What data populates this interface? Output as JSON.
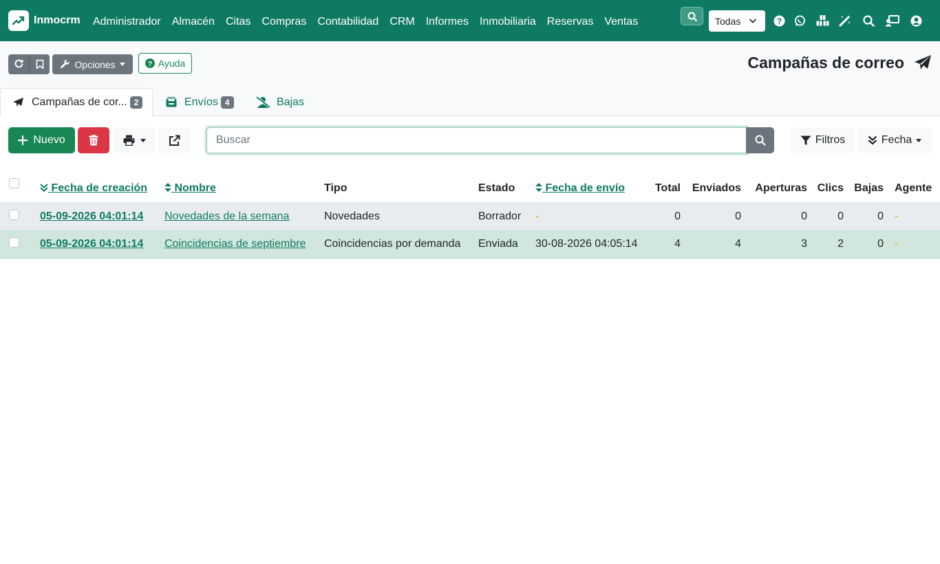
{
  "navbar": {
    "brand": "Inmocrm",
    "menu": [
      "Administrador",
      "Almacén",
      "Citas",
      "Compras",
      "Contabilidad",
      "CRM",
      "Informes",
      "Inmobiliaria",
      "Reservas",
      "Ventas"
    ],
    "company_select": "Todas",
    "icons": [
      "question-circle-icon",
      "whatsapp-icon",
      "cubes-icon",
      "magic-wand-icon",
      "search-icon",
      "screen-user-icon",
      "user-circle-icon"
    ],
    "accent": "#0f7a63"
  },
  "toolbar_top": {
    "options_label": "Opciones",
    "help_label": "Ayuda",
    "page_title": "Campañas de correo"
  },
  "tabs": [
    {
      "label": "Campañas de cor...",
      "badge": "2",
      "icon": "paper-plane-icon",
      "active": true
    },
    {
      "label": "Envíos",
      "badge": "4",
      "icon": "inbox-icon",
      "active": false
    },
    {
      "label": "Bajas",
      "badge": "",
      "icon": "user-slash-icon",
      "active": false
    }
  ],
  "actions": {
    "new_label": "Nuevo",
    "search_placeholder": "Buscar",
    "filters_label": "Filtros",
    "date_label": "Fecha"
  },
  "table": {
    "columns": [
      "Fecha de creación",
      "Nombre",
      "Tipo",
      "Estado",
      "Fecha de envío",
      "Total",
      "Enviados",
      "Aperturas",
      "Clics",
      "Bajas",
      "Agente"
    ],
    "rows": [
      {
        "fecha_creacion": "05-09-2026 04:01:14",
        "nombre": "Novedades de la semana",
        "tipo": "Novedades",
        "estado": "Borrador",
        "fecha_envio": "-",
        "total": "0",
        "enviados": "0",
        "aperturas": "0",
        "clics": "0",
        "bajas": "0",
        "agente": "-"
      },
      {
        "fecha_creacion": "05-09-2026 04:01:14",
        "nombre": "Coincidencias de septiembre",
        "tipo": "Coincidencias por demanda",
        "estado": "Enviada",
        "fecha_envio": "30-08-2026 04:05:14",
        "total": "4",
        "enviados": "4",
        "aperturas": "3",
        "clics": "2",
        "bajas": "0",
        "agente": "-"
      }
    ]
  },
  "colors": {
    "primary": "#0f7a63",
    "success": "#198754",
    "danger": "#dc3545",
    "secondary": "#6c757d",
    "row_selected": "#d1e7dd"
  }
}
